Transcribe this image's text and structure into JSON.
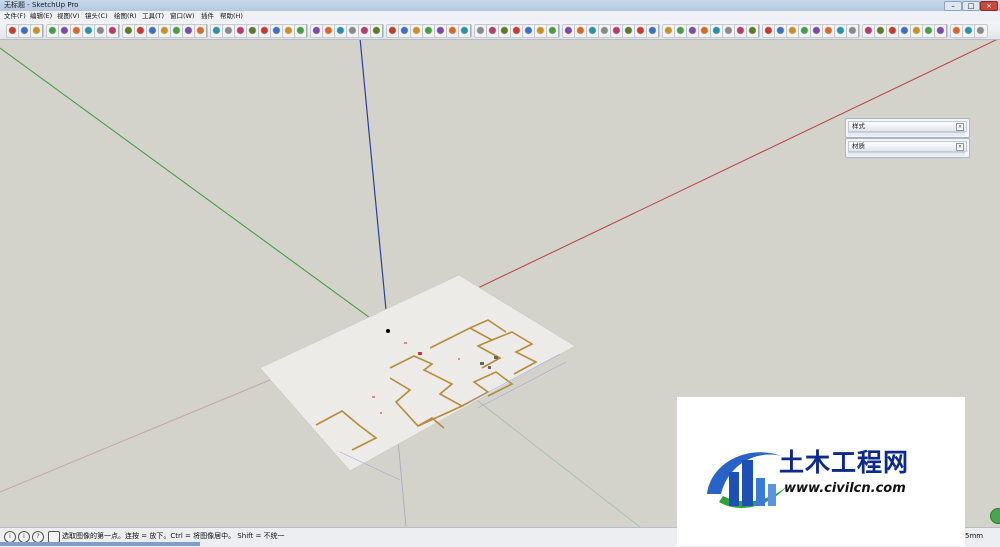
{
  "window": {
    "title": "无标题 - SketchUp Pro",
    "controls": [
      "–",
      "□",
      "×"
    ]
  },
  "menu": {
    "items": [
      "文件(F)",
      "编辑(E)",
      "视图(V)",
      "镜头(C)",
      "绘图(R)",
      "工具(T)",
      "窗口(W)",
      "插件",
      "帮助(H)"
    ]
  },
  "trays": [
    {
      "label": "样式",
      "close": "×"
    },
    {
      "label": "材质",
      "close": "×"
    }
  ],
  "status": {
    "text": "选取图像的第一点。连按 = 放下。Ctrl = 将图像居中。 Shift = 不统一",
    "icons": [
      "i",
      "i",
      "?"
    ],
    "measure_value": "5mm"
  },
  "watermark": {
    "title": "土木工程网",
    "url": "www.civilcn.com"
  },
  "colors": {
    "axis_red": "#b54040",
    "axis_green": "#3c9a3c",
    "axis_blue": "#2c3f9c",
    "background": "#d4d3cb"
  }
}
